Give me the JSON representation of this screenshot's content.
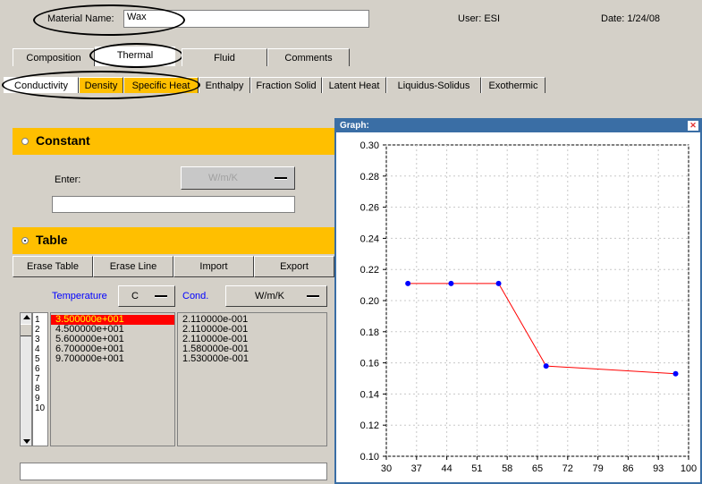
{
  "header": {
    "material_label": "Material Name:",
    "material_value": "Wax",
    "user": "User: ESI",
    "date": "Date: 1/24/08"
  },
  "main_tabs": [
    "Composition",
    "Thermal",
    "Fluid",
    "Comments"
  ],
  "sub_tabs": [
    "Conductivity",
    "Density",
    "Specific Heat",
    "Enthalpy",
    "Fraction Solid",
    "Latent Heat",
    "Liquidus-Solidus",
    "Exothermic"
  ],
  "constant": {
    "title": "Constant",
    "enter_label": "Enter:",
    "unit": "W/m/K",
    "value": ""
  },
  "table": {
    "title": "Table",
    "buttons": [
      "Erase Table",
      "Erase Line",
      "Import",
      "Export"
    ],
    "temp_label": "Temperature",
    "temp_unit": "C",
    "cond_label": "Cond.",
    "cond_unit": "W/m/K",
    "row_numbers": [
      "1",
      "2",
      "3",
      "4",
      "5",
      "6",
      "7",
      "8",
      "9",
      "10"
    ],
    "temperatures": [
      "3.500000e+001",
      "4.500000e+001",
      "5.600000e+001",
      "6.700000e+001",
      "9.700000e+001"
    ],
    "conductivities": [
      "2.110000e-001",
      "2.110000e-001",
      "2.110000e-001",
      "1.580000e-001",
      "1.530000e-001"
    ],
    "bottom_value": ""
  },
  "graph": {
    "title": "Graph:",
    "close": "✕"
  },
  "chart_data": {
    "type": "line",
    "x": [
      35,
      45,
      56,
      67,
      97
    ],
    "y": [
      0.211,
      0.211,
      0.211,
      0.158,
      0.153
    ],
    "xlim": [
      30,
      100
    ],
    "ylim": [
      0.1,
      0.3
    ],
    "xticks": [
      "30",
      "37",
      "44",
      "51",
      "58",
      "65",
      "72",
      "79",
      "86",
      "93",
      "100"
    ],
    "yticks": [
      "0.10",
      "0.12",
      "0.14",
      "0.16",
      "0.18",
      "0.20",
      "0.22",
      "0.24",
      "0.26",
      "0.28",
      "0.30"
    ],
    "grid": true,
    "line_color": "#ff0000",
    "marker_color": "#0000ff"
  }
}
